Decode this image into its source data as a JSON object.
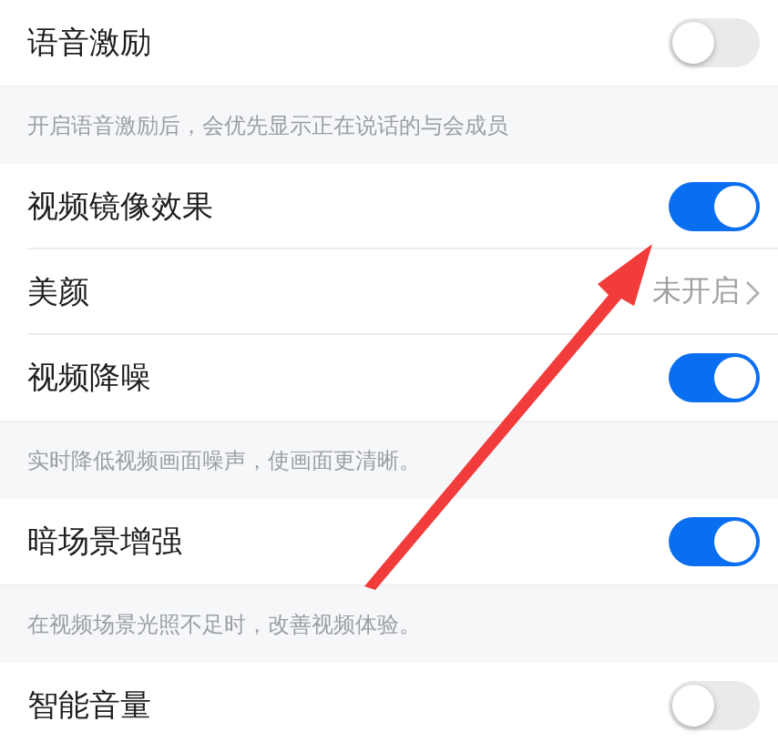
{
  "settings": [
    {
      "kind": "toggle",
      "label": "语音激励",
      "on": false
    },
    {
      "kind": "note",
      "text": "开启语音激励后，会优先显示正在说话的与会成员"
    },
    {
      "kind": "toggle",
      "label": "视频镜像效果",
      "on": true
    },
    {
      "kind": "link",
      "label": "美颜",
      "value": "未开启"
    },
    {
      "kind": "toggle",
      "label": "视频降噪",
      "on": true
    },
    {
      "kind": "note",
      "text": "实时降低视频画面噪声，使画面更清晰。"
    },
    {
      "kind": "toggle",
      "label": "暗场景增强",
      "on": true
    },
    {
      "kind": "note",
      "text": "在视频场景光照不足时，改善视频体验。"
    },
    {
      "kind": "toggle",
      "label": "智能音量",
      "on": false
    }
  ]
}
